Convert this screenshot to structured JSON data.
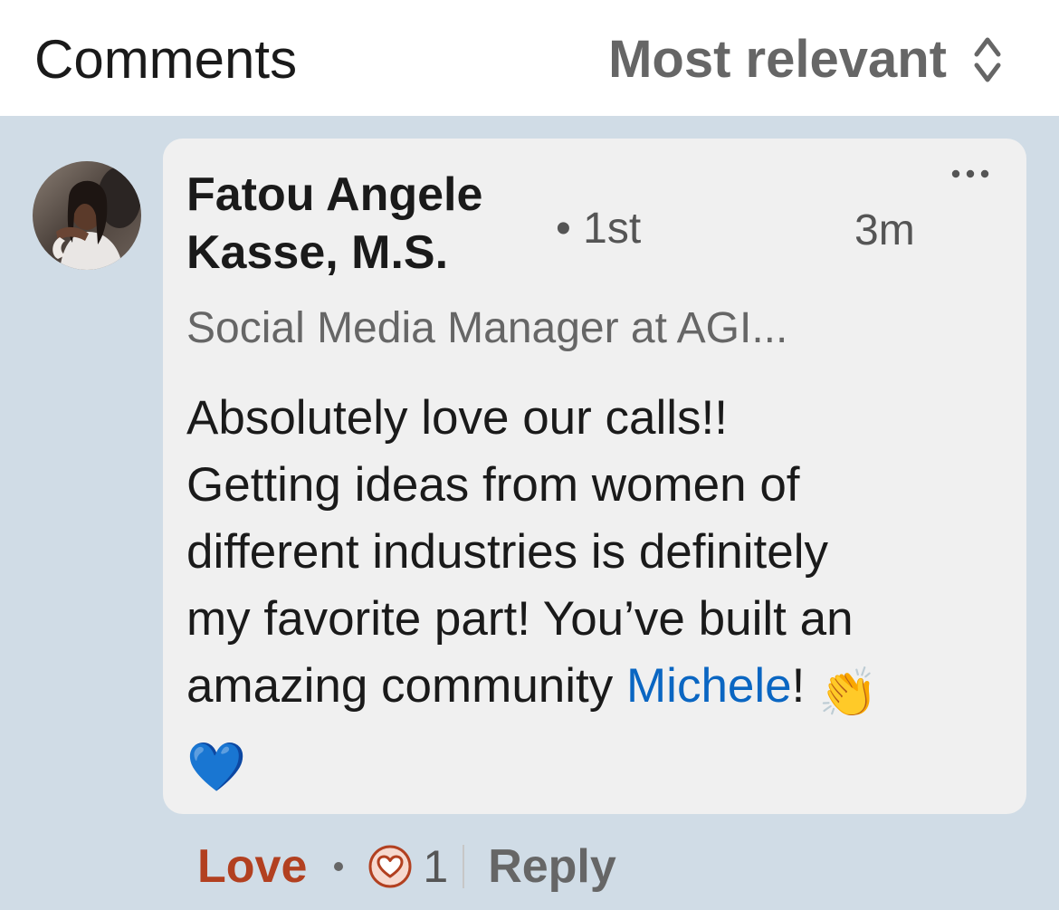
{
  "header": {
    "title": "Comments",
    "sort_label": "Most relevant",
    "sort_icon": "sort-updown-icon"
  },
  "comment": {
    "author_line1": "Fatou Angele",
    "author_line2": "Kasse, M.S.",
    "degree": "• 1st",
    "time": "3m",
    "headline": "Social Media Manager at AGI...",
    "text_line1": "Absolutely love our calls!!",
    "text_line2": "Getting ideas from women of",
    "text_line3": "different industries is definitely",
    "text_line4": "my favorite part! You’ve built an",
    "text_line5_prefix": "amazing community ",
    "mention": "Michele",
    "text_line5_suffix": "! ",
    "clap_emoji": "👏",
    "heart_emoji": "💙",
    "more_icon": "more-horizontal-icon"
  },
  "actions": {
    "reaction_label": "Love",
    "reaction_icon": "love-heart-icon",
    "reaction_count": "1",
    "reply_label": "Reply"
  },
  "colors": {
    "background": "#d0dce6",
    "bubble": "#f0f0f0",
    "mention": "#0a66c2",
    "love": "#b24020"
  }
}
